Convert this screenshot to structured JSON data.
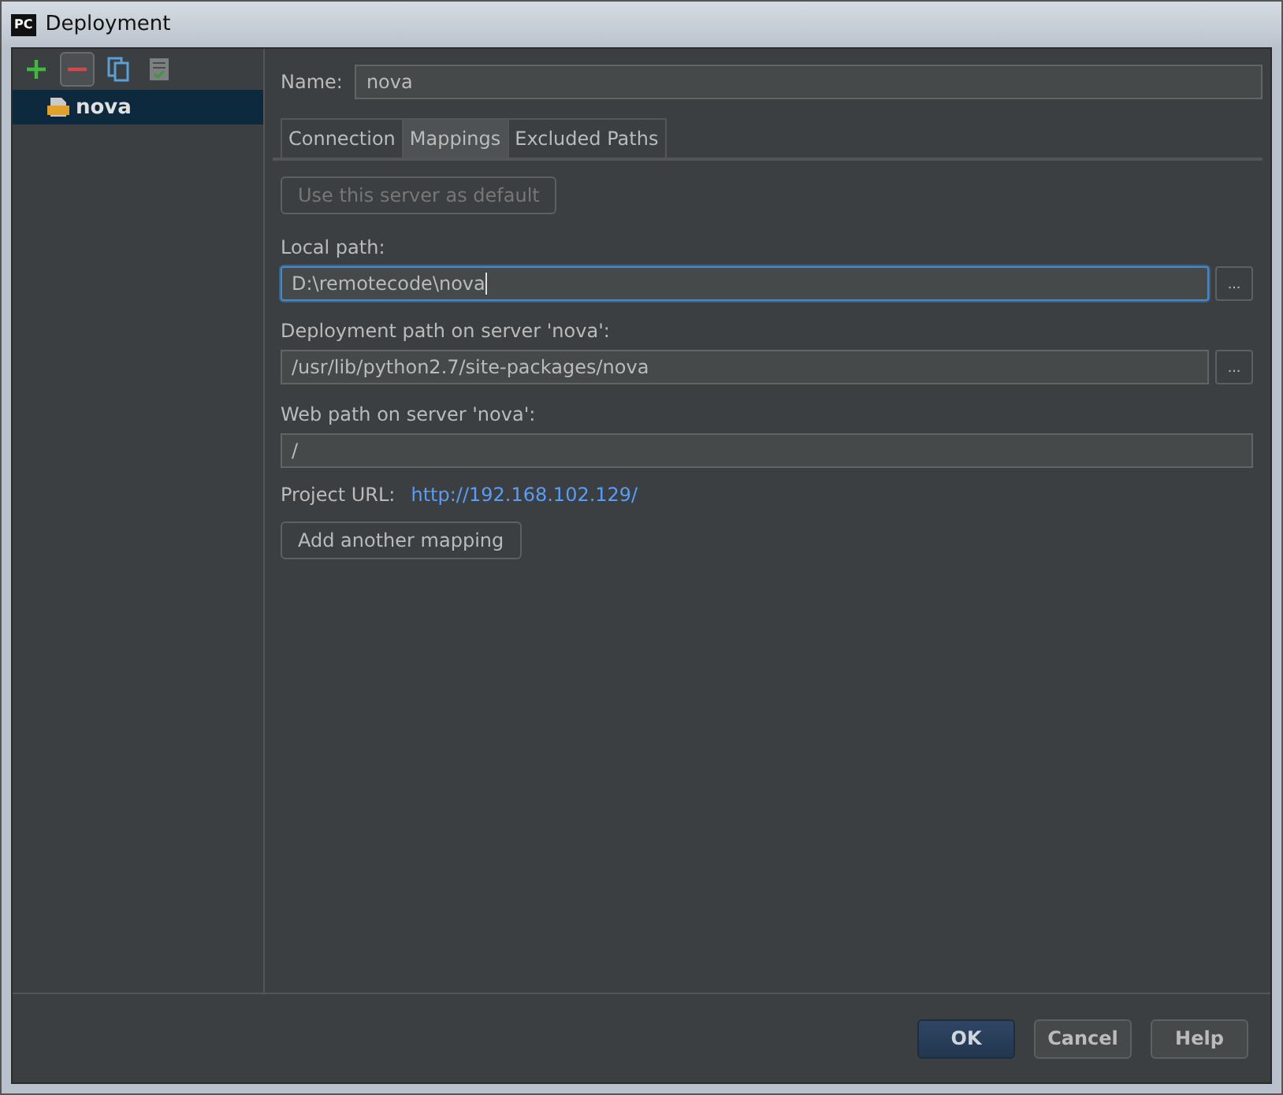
{
  "window": {
    "title": "Deployment",
    "app_badge": "PC"
  },
  "toolbar": [
    {
      "kind": "add",
      "selected": false
    },
    {
      "kind": "remove",
      "selected": true
    },
    {
      "kind": "copy",
      "selected": false
    },
    {
      "kind": "check",
      "selected": false
    }
  ],
  "servers": [
    {
      "name": "nova",
      "selected": true
    }
  ],
  "name_field": {
    "label": "Name:",
    "value": "nova"
  },
  "tabs": [
    {
      "label": "Connection",
      "selected": false
    },
    {
      "label": "Mappings",
      "selected": true
    },
    {
      "label": "Excluded Paths",
      "selected": false
    }
  ],
  "default_button": {
    "label": "Use this server as default",
    "disabled": true
  },
  "paths": [
    {
      "label": "Local path:",
      "value": "D:\\remotecode\\nova",
      "focused": true,
      "browse": "..."
    },
    {
      "label": "Deployment path on server 'nova':",
      "value": "/usr/lib/python2.7/site-packages/nova",
      "focused": false,
      "browse": "..."
    },
    {
      "label": "Web path on server 'nova':",
      "value": "/",
      "focused": false
    }
  ],
  "project_url": {
    "label": "Project URL:",
    "link": "http://192.168.102.129/"
  },
  "add_mapping_button": "Add another mapping",
  "buttons": [
    {
      "label": "OK",
      "primary": true
    },
    {
      "label": "Cancel",
      "primary": false
    },
    {
      "label": "Help",
      "primary": false
    }
  ]
}
